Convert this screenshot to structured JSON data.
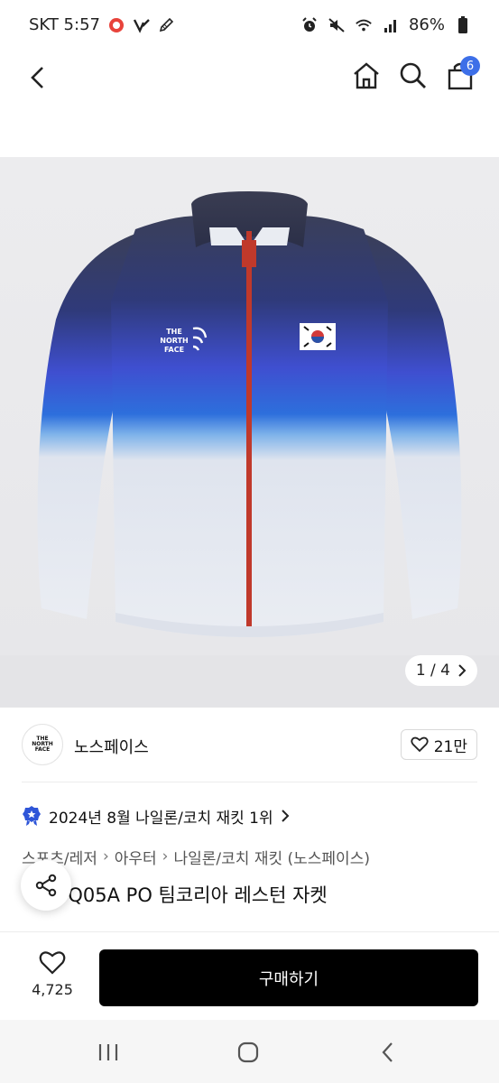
{
  "status_bar": {
    "carrier_time": "SKT 5:57",
    "battery": "86%",
    "icons_left": [
      "no-entry-icon",
      "v-check-icon",
      "pencil-icon"
    ],
    "icons_right": [
      "alarm-icon",
      "mute-icon",
      "wifi-icon",
      "signal-icon",
      "battery-icon"
    ]
  },
  "header": {
    "back_icon": "chevron-left-icon",
    "home_icon": "home-icon",
    "search_icon": "search-icon",
    "cart_icon": "shopping-bag-icon",
    "cart_count": "6",
    "badge_color": "#3d6fe8"
  },
  "hero": {
    "page_indicator": "1 / 4",
    "jacket_logo_text": [
      "THE",
      "NORTH",
      "FACE"
    ]
  },
  "brand": {
    "logo_text": [
      "THE",
      "NORTH",
      "FACE"
    ],
    "name": "노스페이스",
    "like_count": "21만"
  },
  "ranking": {
    "text": "2024년 8월 나일론/코치 재킷 1위"
  },
  "breadcrumb": [
    "스포츠/레저",
    "아우터",
    "나일론/코치 재킷 (노스페이스)"
  ],
  "product": {
    "title": "3Q05A PO 팀코리아 레스턴 자켓"
  },
  "bottom_bar": {
    "wish_count": "4,725",
    "buy_label": "구매하기"
  },
  "nav_bar": {
    "icons": [
      "recent-apps-icon",
      "home-circle-icon",
      "back-nav-icon"
    ]
  }
}
